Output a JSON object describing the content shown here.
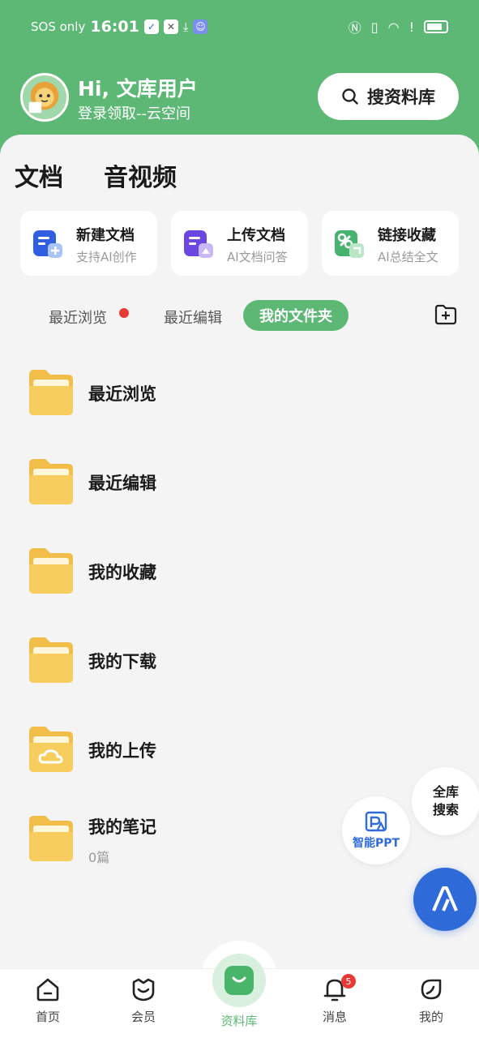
{
  "status_bar": {
    "carrier": "SOS only",
    "time": "16:01",
    "battery_level": 0.8
  },
  "header": {
    "greeting": "Hi, 文库用户",
    "sub_greeting": "登录领取--云空间",
    "search_label": "搜资料库"
  },
  "top_tabs": [
    {
      "label": "文档",
      "active": true
    },
    {
      "label": "音视频",
      "active": false
    }
  ],
  "actions": [
    {
      "title": "新建文档",
      "sub": "支持AI创作",
      "icon": "new-doc-icon"
    },
    {
      "title": "上传文档",
      "sub": "AI文档问答",
      "icon": "upload-doc-icon"
    },
    {
      "title": "链接收藏",
      "sub": "AI总结全文",
      "icon": "link-collect-icon"
    }
  ],
  "sub_tabs": [
    {
      "label": "最近浏览",
      "has_dot": true
    },
    {
      "label": "最近编辑"
    },
    {
      "label": "我的文件夹",
      "active": true
    }
  ],
  "folders": [
    {
      "name": "最近浏览"
    },
    {
      "name": "最近编辑"
    },
    {
      "name": "我的收藏"
    },
    {
      "name": "我的下载"
    },
    {
      "name": "我的上传",
      "icon": "cloud-folder-icon"
    },
    {
      "name": "我的笔记",
      "count": "0篇"
    }
  ],
  "floating": {
    "search_line1": "全库",
    "search_line2": "搜索",
    "ppt_label": "智能PPT"
  },
  "bottom_nav": {
    "items": [
      {
        "label": "首页"
      },
      {
        "label": "会员"
      },
      {
        "label": "资料库",
        "active": true
      },
      {
        "label": "消息",
        "badge": "5"
      },
      {
        "label": "我的"
      }
    ]
  },
  "colors": {
    "brand_green": "#5cb874",
    "accent_blue": "#2f6ad9",
    "folder_yellow": "#f7cd5e",
    "badge_red": "#e83a32"
  }
}
